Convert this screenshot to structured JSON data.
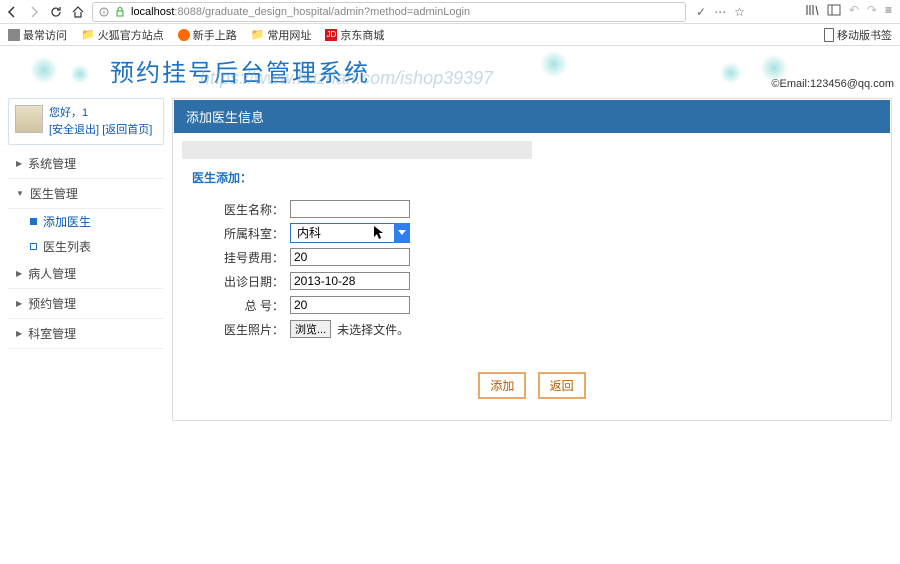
{
  "browser": {
    "url_host": "localhost",
    "url_port": ":8088",
    "url_path": "/graduate_design_hospital/admin?method=adminLogin",
    "bookmarks": {
      "most_visited": "最常访问",
      "huohu": "火狐官方站点",
      "newbie": "新手上路",
      "common": "常用网址",
      "jd_badge": "JD",
      "jd": "京东商城",
      "mobile": "移动版书签"
    }
  },
  "header": {
    "title": "预约挂号后台管理系统",
    "watermark": "https://www.huzhan.com/ishop39397",
    "email": "©Email:123456@qq.com"
  },
  "user": {
    "greeting": "您好，1",
    "logout": "[安全退出]",
    "home": "[返回首页]"
  },
  "menu": {
    "system": "系统管理",
    "doctor": "医生管理",
    "add_doctor": "添加医生",
    "doctor_list": "医生列表",
    "patient": "病人管理",
    "appoint": "预约管理",
    "dept": "科室管理"
  },
  "panel": {
    "title": "添加医生信息",
    "section": "医生添加："
  },
  "form": {
    "labels": {
      "name": "医生名称：",
      "dept": "所属科室：",
      "fee": "挂号费用：",
      "date": "出诊日期：",
      "total": "总 号：",
      "photo": "医生照片："
    },
    "values": {
      "name": "",
      "dept": "内科",
      "fee": "20",
      "date": "2013-10-28",
      "total": "20"
    },
    "file": {
      "browse": "浏览...",
      "no_file": "未选择文件。"
    }
  },
  "buttons": {
    "add": "添加",
    "back": "返回"
  }
}
